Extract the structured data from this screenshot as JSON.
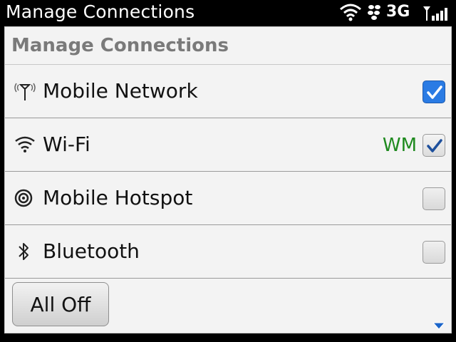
{
  "status_bar": {
    "title": "Manage Connections",
    "network_type": "3G",
    "icons": [
      "wifi-icon",
      "bbm-icon",
      "signal-icon"
    ]
  },
  "panel": {
    "title": "Manage Connections",
    "rows": [
      {
        "label": "Mobile Network",
        "icon": "antenna-icon",
        "status": "",
        "checked": true
      },
      {
        "label": "Wi-Fi",
        "icon": "wifi-icon",
        "status": "WM",
        "checked": true
      },
      {
        "label": "Mobile Hotspot",
        "icon": "hotspot-icon",
        "status": "",
        "checked": false
      },
      {
        "label": "Bluetooth",
        "icon": "bluetooth-icon",
        "status": "",
        "checked": false
      }
    ],
    "all_off_label": "All Off"
  },
  "colors": {
    "accent": "#2a7be4",
    "status_green": "#1f8a1f",
    "header_gray": "#7a7a7a"
  }
}
